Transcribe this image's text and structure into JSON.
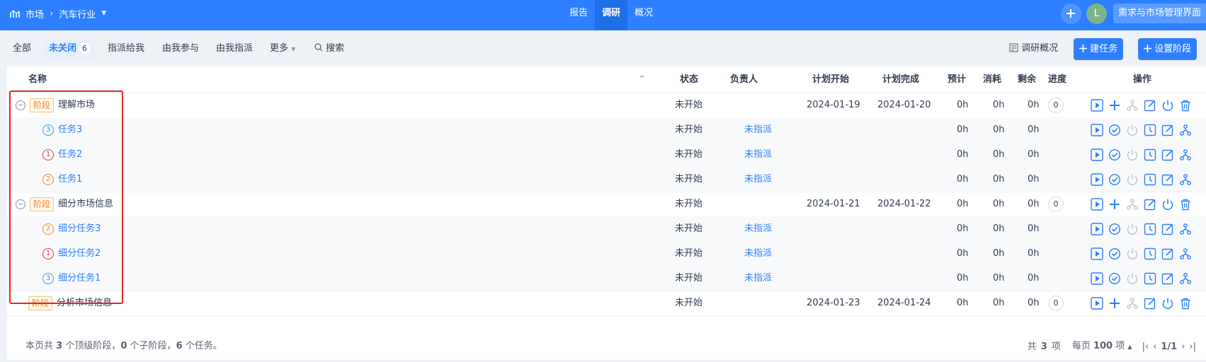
{
  "topbar": {
    "crumb_root": "市场",
    "crumb_current": "汽车行业",
    "tabs": [
      {
        "label": "报告",
        "active": false
      },
      {
        "label": "调研",
        "active": true
      },
      {
        "label": "概况",
        "active": false
      }
    ],
    "avatar_letter": "L",
    "manage_button": "需求与市场管理界面"
  },
  "toolbar": {
    "filters": {
      "all": "全部",
      "open": "未关闭",
      "open_count": "6",
      "assigned_to_me": "指派给我",
      "involved": "由我参与",
      "assigned_by_me": "由我指派",
      "more": "更多",
      "search": "搜索"
    },
    "overview_label": "调研概况",
    "new_task_label": "建任务",
    "set_stage_label": "设置阶段"
  },
  "table": {
    "headers": {
      "name": "名称",
      "status": "状态",
      "assignee": "负责人",
      "plan_start": "计划开始",
      "plan_end": "计划完成",
      "estimate": "预计",
      "consumed": "消耗",
      "left": "剩余",
      "progress": "进度",
      "actions": "操作"
    },
    "stage_tag": "阶段",
    "rows": [
      {
        "kind": "stage",
        "name": "理解市场",
        "status": "未开始",
        "start": "2024-01-19",
        "end": "2024-01-20",
        "est": "0h",
        "con": "0h",
        "left": "0h",
        "progress": "0"
      },
      {
        "kind": "task",
        "pri": "3",
        "name": "任务3",
        "status": "未开始",
        "assignee": "未指派",
        "est": "0h",
        "con": "0h",
        "left": "0h"
      },
      {
        "kind": "task",
        "pri": "1",
        "name": "任务2",
        "status": "未开始",
        "assignee": "未指派",
        "est": "0h",
        "con": "0h",
        "left": "0h"
      },
      {
        "kind": "task",
        "pri": "2",
        "name": "任务1",
        "status": "未开始",
        "assignee": "未指派",
        "est": "0h",
        "con": "0h",
        "left": "0h"
      },
      {
        "kind": "stage",
        "name": "细分市场信息",
        "status": "未开始",
        "start": "2024-01-21",
        "end": "2024-01-22",
        "est": "0h",
        "con": "0h",
        "left": "0h",
        "progress": "0"
      },
      {
        "kind": "task",
        "pri": "2",
        "name": "细分任务3",
        "status": "未开始",
        "assignee": "未指派",
        "est": "0h",
        "con": "0h",
        "left": "0h"
      },
      {
        "kind": "task",
        "pri": "1",
        "name": "细分任务2",
        "status": "未开始",
        "assignee": "未指派",
        "est": "0h",
        "con": "0h",
        "left": "0h"
      },
      {
        "kind": "task",
        "pri": "3",
        "name": "细分任务1",
        "status": "未开始",
        "assignee": "未指派",
        "est": "0h",
        "con": "0h",
        "left": "0h"
      },
      {
        "kind": "stage",
        "name": "分析市场信息",
        "status": "未开始",
        "start": "2024-01-23",
        "end": "2024-01-24",
        "est": "0h",
        "con": "0h",
        "left": "0h",
        "progress": "0"
      }
    ]
  },
  "footer": {
    "summary_prefix": "本页共",
    "summary_stages": "3",
    "summary_mid1": "个顶级阶段，",
    "summary_sub": "0",
    "summary_mid2": "个子阶段，",
    "summary_tasks": "6",
    "summary_suffix": "个任务。",
    "total_prefix": "共",
    "total_count": "3",
    "total_suffix": "项",
    "per_page_prefix": "每页",
    "per_page": "100",
    "per_page_suffix": "项",
    "page": "1/1"
  },
  "colors": {
    "brand": "#2e7fff",
    "stage_tag": "#e6892e",
    "highlight": "#e32626"
  }
}
